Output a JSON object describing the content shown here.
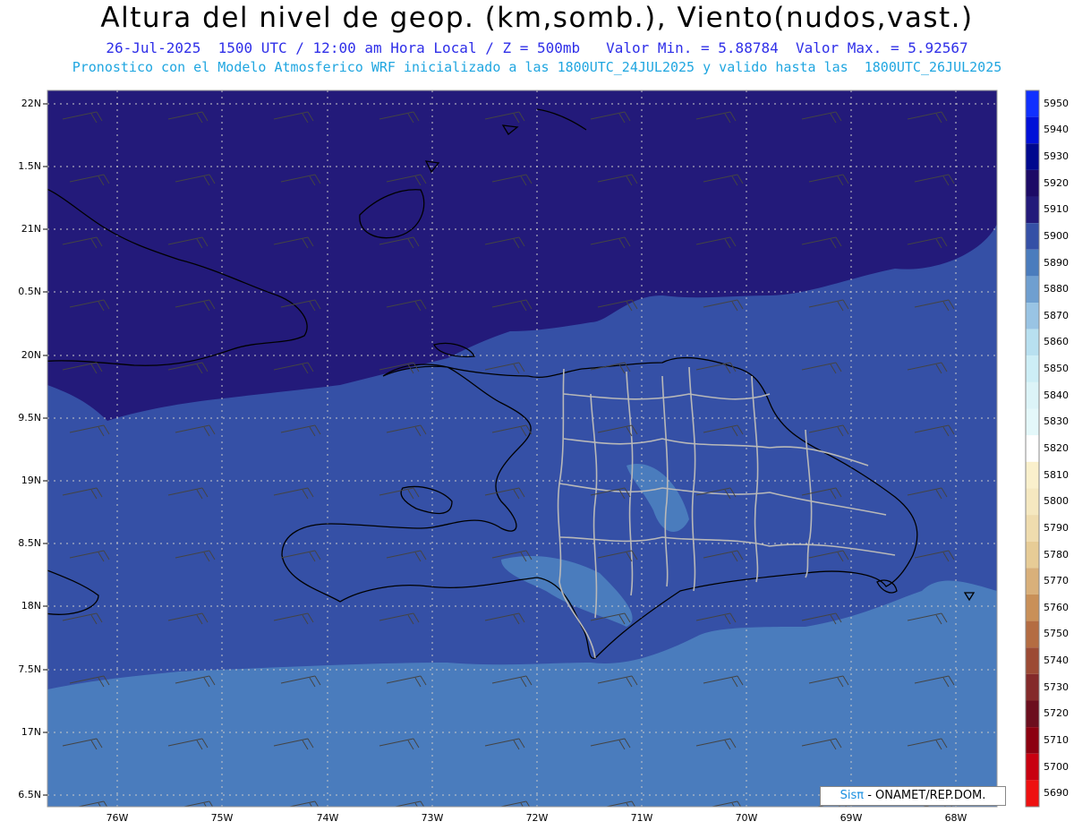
{
  "header": {
    "title": "Altura del nivel de geop. (km,somb.), Viento(nudos,vast.)",
    "line2": "26-Jul-2025  1500 UTC / 12:00 am Hora Local / Z = 500mb   Valor Min. = 5.88784  Valor Max. = 5.92567",
    "line3": "Pronostico con el Modelo Atmosferico WRF inicializado a las 1800UTC_24JUL2025 y valido hasta las  1800UTC_26JUL2025"
  },
  "axes": {
    "lat_labels": [
      "22N",
      "1.5N",
      "21N",
      "0.5N",
      "20N",
      "9.5N",
      "19N",
      "8.5N",
      "18N",
      "7.5N",
      "17N",
      "6.5N"
    ],
    "lon_labels": [
      "76W",
      "75W",
      "74W",
      "73W",
      "72W",
      "71W",
      "70W",
      "69W",
      "68W"
    ]
  },
  "colorbar": {
    "levels": [
      "5950",
      "5940",
      "5930",
      "5920",
      "5910",
      "5900",
      "5890",
      "5880",
      "5870",
      "5860",
      "5850",
      "5840",
      "5830",
      "5820",
      "5810",
      "5800",
      "5790",
      "5780",
      "5770",
      "5760",
      "5750",
      "5740",
      "5730",
      "5720",
      "5710",
      "5700",
      "5690"
    ],
    "colors": [
      "#1030ff",
      "#0010d8",
      "#00088e",
      "#1c0a66",
      "#231a7a",
      "#3550a6",
      "#4a7cbd",
      "#6f9fd0",
      "#99c4e4",
      "#b8e0f0",
      "#cdeef6",
      "#dcf4f8",
      "#e4f8fa",
      "#ffffff",
      "#faf0cc",
      "#f5e8c0",
      "#efdcae",
      "#e7cc96",
      "#d9b07a",
      "#c99058",
      "#b46c42",
      "#9c4a34",
      "#842a2a",
      "#6c0e1e",
      "#8c0010",
      "#c80010",
      "#ee1010"
    ]
  },
  "map": {
    "field_colors": {
      "north": "#231a7a",
      "middle": "#3550a6",
      "south": "#4a7cbd",
      "patch": "#6f9fd0"
    }
  },
  "credit": {
    "sis": "Sisπ",
    "text": " - ONAMET/REP.DOM."
  }
}
